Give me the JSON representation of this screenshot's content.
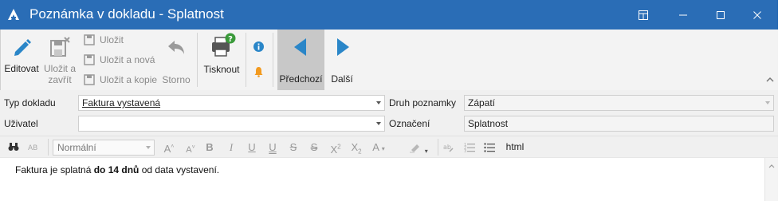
{
  "window": {
    "title": "Poznámka v dokladu - Splatnost"
  },
  "ribbon": {
    "edit_label": "Editovat",
    "save_close_label_1": "Uložit a",
    "save_close_label_2": "zavřít",
    "save_label": "Uložit",
    "save_new_label": "Uložit a nová",
    "save_copy_label": "Uložit a kopie",
    "cancel_label": "Storno",
    "print_label": "Tisknout",
    "prev_label": "Předchozí",
    "next_label": "Další"
  },
  "form": {
    "doc_type_label": "Typ dokladu",
    "doc_type_value": "Faktura vystavená",
    "user_label": "Uživatel",
    "user_value": "",
    "note_kind_label": "Druh poznamky",
    "note_kind_value": "Zápatí",
    "designation_label": "Označení",
    "designation_value": "Splatnost"
  },
  "editor_toolbar": {
    "style_value": "Normální",
    "html_label": "html"
  },
  "editor": {
    "text_before": "Faktura je splatná ",
    "text_bold": "do 14 dnů",
    "text_after": " od data vystavení."
  },
  "colors": {
    "titlebar": "#2a6db6",
    "accent_blue": "#2a86c8",
    "active_tab": "#c8c8c8"
  }
}
